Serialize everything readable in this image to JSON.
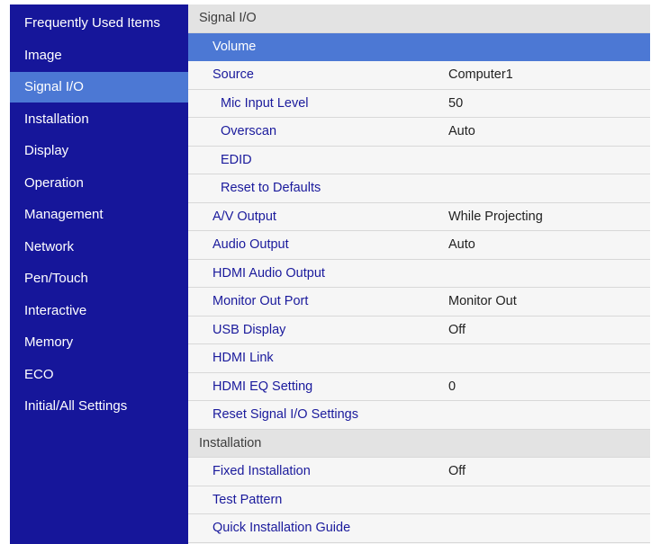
{
  "sidebar": {
    "items": [
      {
        "label": "Frequently Used Items",
        "selected": false
      },
      {
        "label": "Image",
        "selected": false
      },
      {
        "label": "Signal I/O",
        "selected": true
      },
      {
        "label": "Installation",
        "selected": false
      },
      {
        "label": "Display",
        "selected": false
      },
      {
        "label": "Operation",
        "selected": false
      },
      {
        "label": "Management",
        "selected": false
      },
      {
        "label": "Network",
        "selected": false
      },
      {
        "label": "Pen/Touch",
        "selected": false
      },
      {
        "label": "Interactive",
        "selected": false
      },
      {
        "label": "Memory",
        "selected": false
      },
      {
        "label": "ECO",
        "selected": false
      },
      {
        "label": "Initial/All Settings",
        "selected": false
      }
    ]
  },
  "main": {
    "rows": [
      {
        "type": "header",
        "label": "Signal I/O"
      },
      {
        "type": "item",
        "level": 0,
        "label": "Volume",
        "value": "",
        "highlighted": true
      },
      {
        "type": "item",
        "level": 0,
        "label": "Source",
        "value": "Computer1"
      },
      {
        "type": "item",
        "level": 1,
        "label": "Mic Input Level",
        "value": "50"
      },
      {
        "type": "item",
        "level": 1,
        "label": "Overscan",
        "value": "Auto"
      },
      {
        "type": "item",
        "level": 1,
        "label": "EDID",
        "value": ""
      },
      {
        "type": "item",
        "level": 1,
        "label": "Reset to Defaults",
        "value": ""
      },
      {
        "type": "item",
        "level": 0,
        "label": "A/V Output",
        "value": "While Projecting"
      },
      {
        "type": "item",
        "level": 0,
        "label": "Audio Output",
        "value": "Auto"
      },
      {
        "type": "item",
        "level": 0,
        "label": "HDMI Audio Output",
        "value": ""
      },
      {
        "type": "item",
        "level": 0,
        "label": "Monitor Out Port",
        "value": "Monitor Out"
      },
      {
        "type": "item",
        "level": 0,
        "label": "USB Display",
        "value": "Off"
      },
      {
        "type": "item",
        "level": 0,
        "label": "HDMI Link",
        "value": ""
      },
      {
        "type": "item",
        "level": 0,
        "label": "HDMI EQ Setting",
        "value": "0"
      },
      {
        "type": "item",
        "level": 0,
        "label": "Reset Signal I/O Settings",
        "value": ""
      },
      {
        "type": "header",
        "label": "Installation"
      },
      {
        "type": "item",
        "level": 0,
        "label": "Fixed Installation",
        "value": "Off"
      },
      {
        "type": "item",
        "level": 0,
        "label": "Test Pattern",
        "value": ""
      },
      {
        "type": "item",
        "level": 0,
        "label": "Quick Installation Guide",
        "value": ""
      }
    ]
  }
}
